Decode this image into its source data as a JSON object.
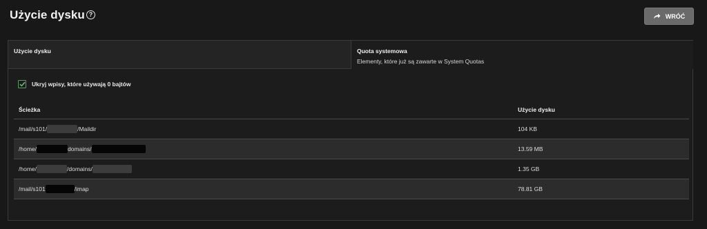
{
  "header": {
    "title": "Użycie dysku",
    "help_icon": "?",
    "back_label": "WRÓĆ"
  },
  "tabs": {
    "usage": {
      "label": "Użycie dysku"
    },
    "quota": {
      "label": "Quota systemowa",
      "description": "Elementy, które już są zawarte w System Quotas"
    }
  },
  "hide_zero": {
    "label": "Ukryj wpisy, które używają 0 bajtów",
    "checked": true
  },
  "table": {
    "columns": {
      "path": "Ścieżka",
      "size": "Użycie dysku"
    },
    "rows": [
      {
        "parts": [
          "/mail/s101/",
          "/Maildir"
        ],
        "size": "104 KB"
      },
      {
        "parts": [
          "/home/",
          "domains/",
          ""
        ],
        "size": "13.59 MB"
      },
      {
        "parts": [
          "/home/",
          "/domains/",
          ""
        ],
        "size": "1.35 GB"
      },
      {
        "parts": [
          "/mail/s101",
          "/imap"
        ],
        "size": "78.81 GB"
      }
    ]
  },
  "colors": {
    "background": "#181818",
    "panel": "#1c1c1c",
    "checkbox_accent": "#5e9a66",
    "button": "#6a6a6a"
  }
}
